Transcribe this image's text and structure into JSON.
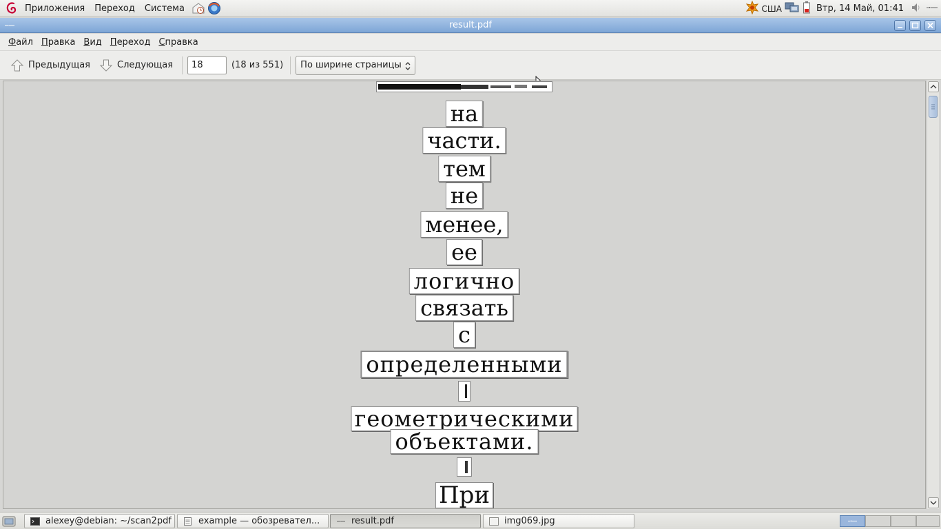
{
  "top_panel": {
    "menus": [
      "Приложения",
      "Переход",
      "Система"
    ],
    "keyboard_layout": "США",
    "clock": "Втр, 14 Май, 01:41"
  },
  "window": {
    "title": "result.pdf"
  },
  "menubar": [
    {
      "underline": "Ф",
      "rest": "айл"
    },
    {
      "underline": "П",
      "rest": "равка"
    },
    {
      "underline": "В",
      "rest": "ид"
    },
    {
      "underline": "П",
      "rest": "ереход"
    },
    {
      "underline": "С",
      "rest": "правка"
    }
  ],
  "toolbar": {
    "prev_label": "Предыдущая",
    "next_label": "Следующая",
    "page_value": "18",
    "page_count": "(18 из 551)",
    "zoom_value": "По ширине страницы"
  },
  "document": {
    "words": [
      "на",
      "части.",
      "тем",
      "не",
      "менее,",
      "ее",
      "логично",
      "связать",
      "с",
      "определенными",
      "геометрическими",
      "объектами.",
      "При"
    ]
  },
  "taskbar": {
    "tasks": [
      {
        "label": "alexey@debian: ~/scan2pdf",
        "icon": "terminal-icon"
      },
      {
        "label": "example — обозревател...",
        "icon": "file-manager-icon"
      },
      {
        "label": "result.pdf",
        "icon": "document-viewer-icon"
      },
      {
        "label": "img069.jpg",
        "icon": "image-icon"
      }
    ]
  },
  "colors": {
    "titlebar": "#7ea6d6",
    "viewport_bg": "#d4d4d2"
  }
}
